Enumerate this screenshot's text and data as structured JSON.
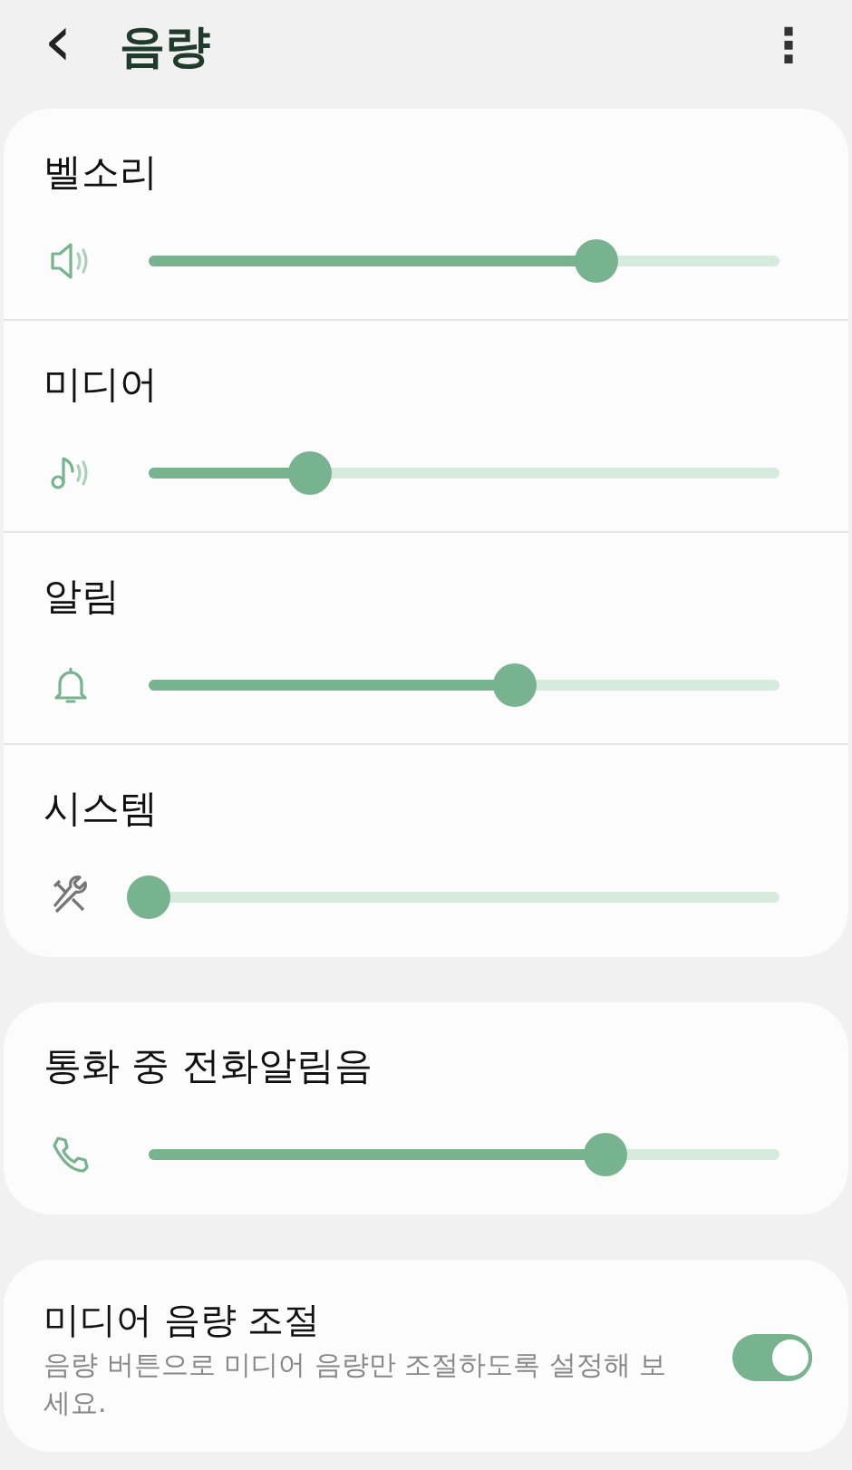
{
  "header": {
    "back": "‹",
    "title": "음량",
    "menu": "⋮"
  },
  "volume_groups": [
    {
      "sliders": [
        {
          "label": "벨소리",
          "level": 0.736
        },
        {
          "label": "미디어",
          "level": 0.266
        },
        {
          "label": "알림",
          "level": 0.6
        },
        {
          "label": "시스템",
          "level": 0.0
        }
      ]
    },
    {
      "sliders": [
        {
          "label": "통화 중 전화알림음",
          "level": 0.75
        }
      ]
    }
  ],
  "media_control": {
    "title": "미디어 음량 조절",
    "description": "음량 버튼으로 미디어 음량만 조절하도록 설정해 보세요.",
    "on": true
  }
}
